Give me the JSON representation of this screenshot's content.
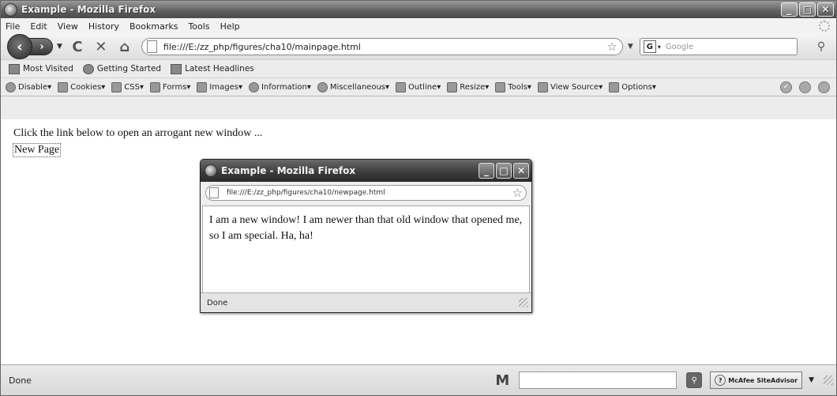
{
  "window": {
    "title": "Example - Mozilla Firefox"
  },
  "menu": {
    "items": [
      "File",
      "Edit",
      "View",
      "History",
      "Bookmarks",
      "Tools",
      "Help"
    ]
  },
  "nav": {
    "url": "file:///E:/zz_php/figures/cha10/mainpage.html",
    "search_placeholder": "Google"
  },
  "bookmarks": {
    "items": [
      "Most Visited",
      "Getting Started",
      "Latest Headlines"
    ]
  },
  "devtoolbar": {
    "items": [
      "Disable▾",
      "Cookies▾",
      "CSS▾",
      "Forms▾",
      "Images▾",
      "Information▾",
      "Miscellaneous▾",
      "Outline▾",
      "Resize▾",
      "Tools▾",
      "View Source▾",
      "Options▾"
    ]
  },
  "page": {
    "intro": "Click the link below to open an arrogant new window ...",
    "link": "New Page"
  },
  "status": {
    "text": "Done",
    "siteadvisor": "McAfee SiteAdvisor"
  },
  "popup": {
    "title": "Example - Mozilla Firefox",
    "url": "file:///E:/zz_php/figures/cha10/newpage.html",
    "body": "I am a new window! I am newer than that old window that opened me, so I am special. Ha, ha!",
    "status": "Done"
  }
}
